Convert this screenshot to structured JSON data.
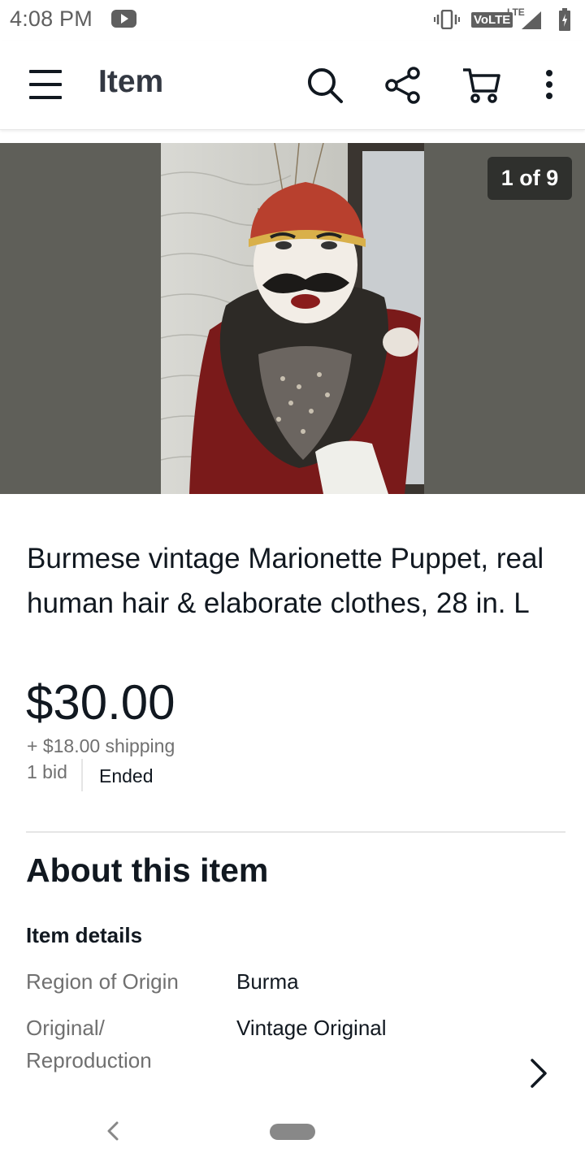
{
  "status_bar": {
    "time": "4:08 PM",
    "volte": "VoLTE",
    "lte": "LTE"
  },
  "app_bar": {
    "title": "Item",
    "icons": [
      "menu-icon",
      "search-icon",
      "share-icon",
      "cart-icon",
      "more-icon"
    ]
  },
  "gallery": {
    "counter": "1 of 9"
  },
  "item": {
    "title": "Burmese vintage Marionette Puppet, real human hair & elaborate clothes, 28 in. L",
    "price": "$30.00",
    "shipping": "+ $18.00 shipping",
    "bids": "1 bid",
    "status": "Ended"
  },
  "about": {
    "heading": "About this item",
    "details_heading": "Item details",
    "specs": [
      {
        "label": "Region of Origin",
        "value": "Burma"
      },
      {
        "label": "Original/ Reproduction",
        "value": "Vintage Original"
      }
    ]
  },
  "colors": {
    "text_primary": "#111820",
    "text_secondary": "#707070",
    "hero_background": "#5f5f59",
    "badge_background": "#2f302d"
  }
}
